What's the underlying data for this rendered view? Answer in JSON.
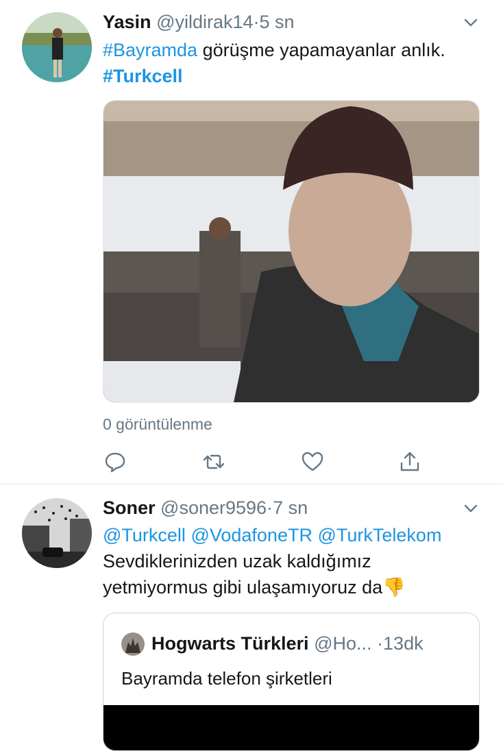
{
  "tweet1": {
    "name": "Yasin",
    "handle": "@yildirak14",
    "sep": "·",
    "time": "5 sn",
    "hashtag1": "#Bayramda",
    "text_mid": " görüşme yapamayanlar anlık. ",
    "hashtag2": "#Turkcell",
    "views": "0 görüntülenme"
  },
  "tweet2": {
    "name": "Soner",
    "handle": "@soner9596",
    "sep": "·",
    "time": "7 sn",
    "mention1": "@Turkcell",
    "mention2": "@VodafoneTR",
    "mention3": "@TurkTelekom",
    "text": "Sevdiklerinizden uzak kaldığımız yetmiyormus gibi ulaşamıyoruz da",
    "emoji": "👎"
  },
  "quote": {
    "name": "Hogwarts Türkleri",
    "handle": "@Ho...",
    "sep": "·",
    "time": "13dk",
    "text": "Bayramda telefon şirketleri"
  },
  "colors": {
    "accent": "#1b95e0",
    "muted": "#657786",
    "text": "#14171a",
    "divider": "#e1e8ed"
  },
  "icons": [
    "chevron-down-icon",
    "reply-icon",
    "retweet-icon",
    "like-icon",
    "share-icon",
    "thumbs-down-emoji"
  ]
}
